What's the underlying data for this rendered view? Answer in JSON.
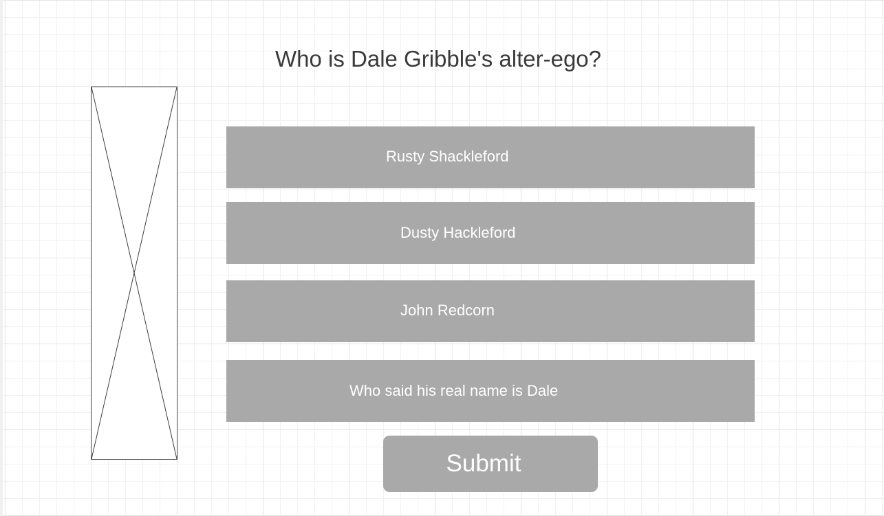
{
  "question": {
    "text": "Who is Dale Gribble's alter-ego?"
  },
  "image": {
    "icon": "image-placeholder-icon"
  },
  "answers": [
    {
      "label": "Rusty Shackleford"
    },
    {
      "label": "Dusty Hackleford"
    },
    {
      "label": "John Redcorn"
    },
    {
      "label": "Who said his real name is Dale"
    }
  ],
  "submit": {
    "label": "Submit"
  },
  "colors": {
    "button_background": "#a9a9a9",
    "button_text": "#ffffff",
    "question_text": "#3a3a3a",
    "grid_line": "#e4e4e4"
  }
}
